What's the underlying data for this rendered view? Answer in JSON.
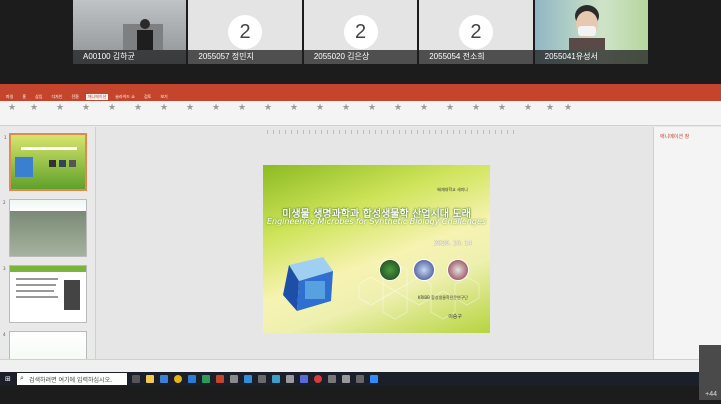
{
  "participants": [
    {
      "name": "A00100 김하균",
      "type": "camera"
    },
    {
      "name": "2055057 정민지",
      "number": "2"
    },
    {
      "name": "2055020 김은상",
      "number": "2"
    },
    {
      "name": "2055054 전소희",
      "number": "2"
    },
    {
      "name": "2055041유성서",
      "type": "camera"
    }
  ],
  "ppt": {
    "accent_color": "#c4452b",
    "ribbon_tabs": [
      "파일",
      "홈",
      "삽입",
      "디자인",
      "전환",
      "애니메이션",
      "슬라이드 쇼",
      "검토",
      "보기"
    ],
    "active_tab": "애니메이션",
    "right_pane_title": "애니메이션 창",
    "slide_numbers": [
      "1",
      "2",
      "3",
      "4"
    ],
    "slide": {
      "subtitle": "배재대학교 세미나",
      "title_kr": "미생물 생명과학과 합성생물학 산업시대 도래",
      "title_en": "Engineering Microbes for Synthetic Biology Challenges",
      "date": "2020. 10. 14",
      "org": "KRIBB 합성생물학전문연구단",
      "author": "이승구"
    }
  },
  "taskbar": {
    "search_placeholder": "검색하려면 여기에 입력하십시오."
  },
  "more_participants": "+44"
}
